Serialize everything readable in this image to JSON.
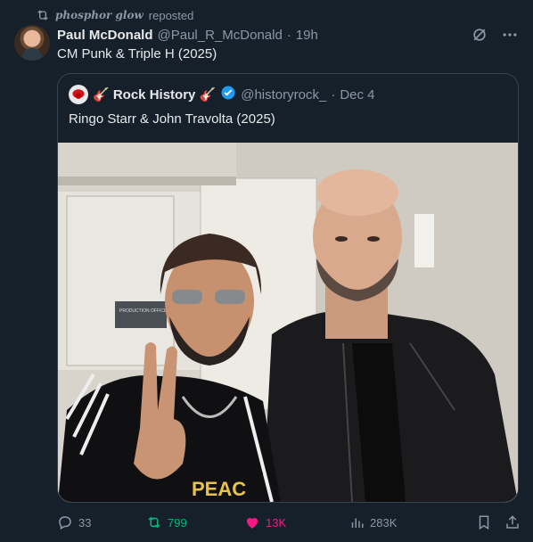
{
  "repost": {
    "user": "phosphor glow",
    "label": "reposted"
  },
  "post": {
    "author_name": "Paul McDonald",
    "author_handle": "@Paul_R_McDonald",
    "separator": "·",
    "time": "19h",
    "text": "CM Punk & Triple H (2025)"
  },
  "quote": {
    "author_name": "🎸 Rock History 🎸",
    "author_handle": "@historyrock_",
    "separator": "·",
    "date": "Dec 4",
    "text": "Ringo Starr & John Travolta (2025)",
    "photo_sign": "PRODUCTION OFFICE STAGE",
    "shirt_text": "PEAC"
  },
  "actions": {
    "replies": "33",
    "reposts": "799",
    "likes": "13K",
    "views": "283K"
  },
  "colors": {
    "background": "#15202b",
    "accent_blue": "#1d9bf0",
    "repost_green": "#00ba7c",
    "like_pink": "#f91880",
    "muted": "#8b98a5"
  },
  "icons": [
    "repost-icon",
    "grok-icon",
    "more-icon",
    "verified-icon",
    "reply-icon",
    "like-icon",
    "views-icon",
    "bookmark-icon",
    "share-icon"
  ]
}
